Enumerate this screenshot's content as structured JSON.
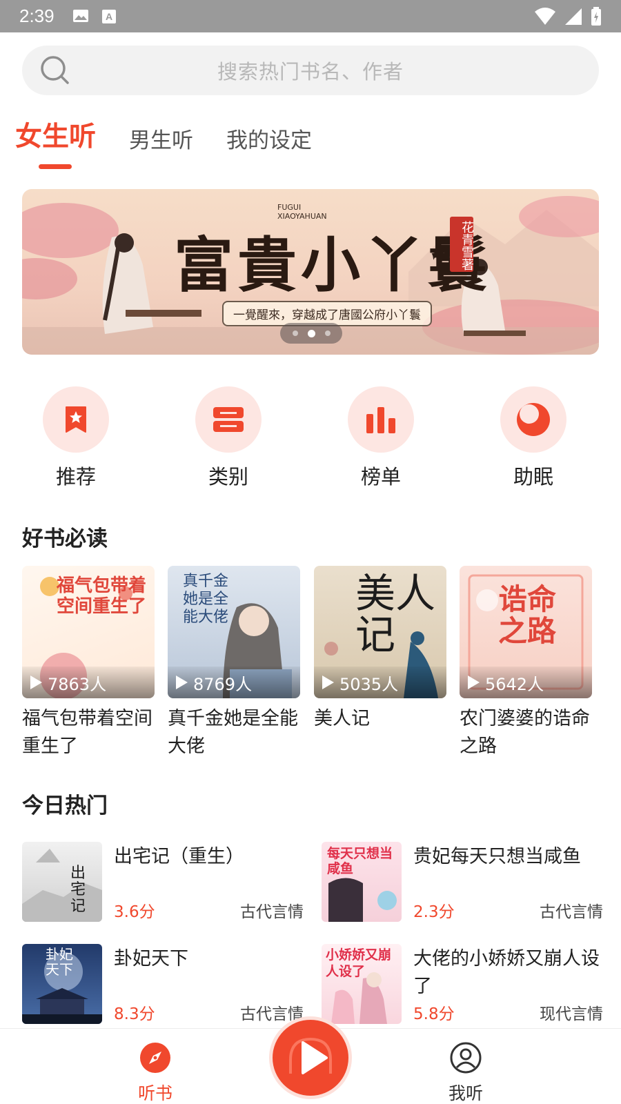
{
  "status_bar": {
    "time": "2:39"
  },
  "search": {
    "placeholder": "搜索热门书名、作者"
  },
  "tabs": [
    {
      "label": "女生听",
      "active": true
    },
    {
      "label": "男生听",
      "active": false
    },
    {
      "label": "我的设定",
      "active": false
    }
  ],
  "banner": {
    "title": "富貴小丫鬟",
    "title_en_1": "FUGUI",
    "title_en_2": "XIAOYAHUAN",
    "author": "花青雪著",
    "subtitle": "一覺醒來，穿越成了唐國公府小丫鬟",
    "slide_count": 3,
    "active_slide": 2
  },
  "categories": [
    {
      "label": "推荐",
      "icon": "bookmark-star-icon"
    },
    {
      "label": "类别",
      "icon": "list-icon"
    },
    {
      "label": "榜单",
      "icon": "bar-chart-icon"
    },
    {
      "label": "助眠",
      "icon": "moon-icon"
    }
  ],
  "good_books": {
    "title": "好书必读",
    "items": [
      {
        "title": "福气包带着空间重生了",
        "listeners": "7863人",
        "cover_text": "福气包带着空间重生了"
      },
      {
        "title": "真千金她是全能大佬",
        "listeners": "8769人",
        "cover_text": "真千金她是全能大佬"
      },
      {
        "title": "美人记",
        "listeners": "5035人",
        "cover_text": "美人记"
      },
      {
        "title": "农门婆婆的诰命之路",
        "listeners": "5642人",
        "cover_text": "诰命之路"
      }
    ]
  },
  "hot_today": {
    "title": "今日热门",
    "items": [
      {
        "title": "出宅记（重生）",
        "score": "3.6分",
        "genre": "古代言情",
        "cover_text": "出宅记"
      },
      {
        "title": "贵妃每天只想当咸鱼",
        "score": "2.3分",
        "genre": "古代言情",
        "cover_text": "每天只想当咸鱼"
      },
      {
        "title": "卦妃天下",
        "score": "8.3分",
        "genre": "古代言情",
        "cover_text": "卦妃天下"
      },
      {
        "title": "大佬的小娇娇又崩人设了",
        "score": "5.8分",
        "genre": "现代言情",
        "cover_text": "小娇娇又崩人设了"
      }
    ]
  },
  "bottom_nav": {
    "items": [
      {
        "label": "听书",
        "active": true,
        "icon": "compass-icon"
      },
      {
        "label": "我听",
        "active": false,
        "icon": "user-icon"
      }
    ],
    "center_icon": "play-icon"
  },
  "colors": {
    "accent": "#f0482d",
    "accent_light": "#fde6e2",
    "text": "#222222",
    "muted": "#b8b8b8"
  }
}
